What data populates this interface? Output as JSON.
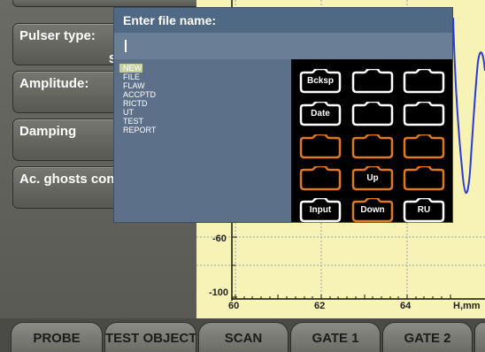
{
  "params": [
    {
      "label": "Pulser type:",
      "value": "Sp"
    },
    {
      "label": "Amplitude:",
      "value": ""
    },
    {
      "label": "Damping",
      "value": ""
    },
    {
      "label": "Ac. ghosts con",
      "value": ""
    }
  ],
  "chart": {
    "y_ticks": [
      "-60",
      "-100"
    ],
    "x_ticks": [
      "60",
      "62",
      "64"
    ],
    "x_unit": "H,mm"
  },
  "tabs": [
    "PROBE",
    "TEST OBJECT",
    "SCAN",
    "GATE 1",
    "GATE 2"
  ],
  "dialog": {
    "title": "Enter file name:",
    "input_value": "",
    "items": [
      "NEW",
      "FILE",
      "FLAW",
      "ACCPTD",
      "RICTD",
      "UT",
      "TEST",
      "REPORT"
    ],
    "keys": [
      {
        "label": "Bcksp",
        "color": "#ffffff"
      },
      {
        "label": "",
        "color": "#ffffff"
      },
      {
        "label": "",
        "color": "#ffffff"
      },
      {
        "label": "Date",
        "color": "#ffffff"
      },
      {
        "label": "",
        "color": "#ffffff"
      },
      {
        "label": "",
        "color": "#ffffff"
      },
      {
        "label": "",
        "color": "#e07a1e"
      },
      {
        "label": "",
        "color": "#e07a1e"
      },
      {
        "label": "",
        "color": "#e07a1e"
      },
      {
        "label": "",
        "color": "#e07a1e"
      },
      {
        "label": "Up",
        "color": "#e07a1e"
      },
      {
        "label": "",
        "color": "#e07a1e"
      },
      {
        "label": "Input",
        "color": "#ffffff"
      },
      {
        "label": "Down",
        "color": "#e07a1e"
      },
      {
        "label": "RU",
        "color": "#ffffff"
      }
    ]
  }
}
